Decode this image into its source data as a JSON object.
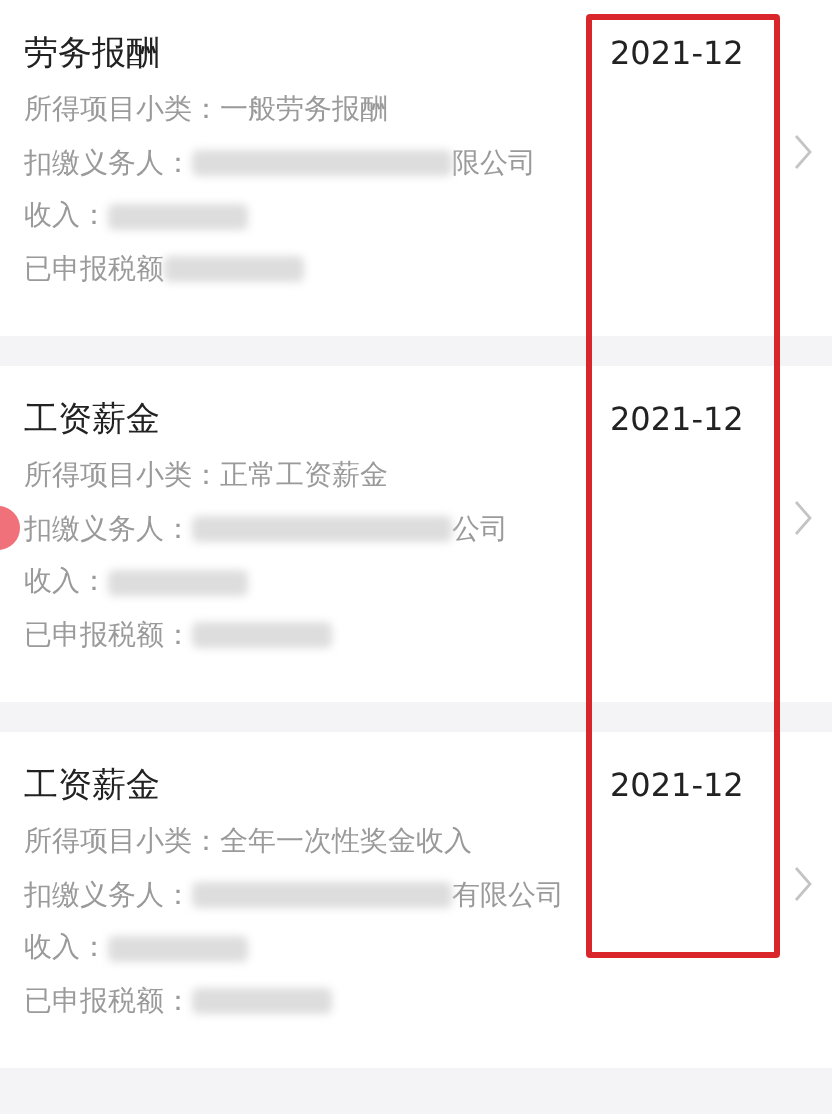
{
  "records": [
    {
      "title": "劳务报酬",
      "period": "2021-12",
      "subcategory_label": "所得项目小类：",
      "subcategory": "一般劳务报酬",
      "payer_label": "扣缴义务人：",
      "payer_visible": "限公司",
      "income_label": "收入：",
      "tax_label": "已申报税额"
    },
    {
      "title": "工资薪金",
      "period": "2021-12",
      "subcategory_label": "所得项目小类：",
      "subcategory": "正常工资薪金",
      "payer_label": "扣缴义务人：",
      "payer_visible": "公司",
      "income_label": "收入：",
      "tax_label": "已申报税额："
    },
    {
      "title": "工资薪金",
      "period": "2021-12",
      "subcategory_label": "所得项目小类：",
      "subcategory": "全年一次性奖金收入",
      "payer_label": "扣缴义务人：",
      "payer_visible": "有限公司",
      "income_label": "收入：",
      "tax_label": "已申报税额："
    }
  ],
  "highlight_box": true,
  "floating_button": true
}
